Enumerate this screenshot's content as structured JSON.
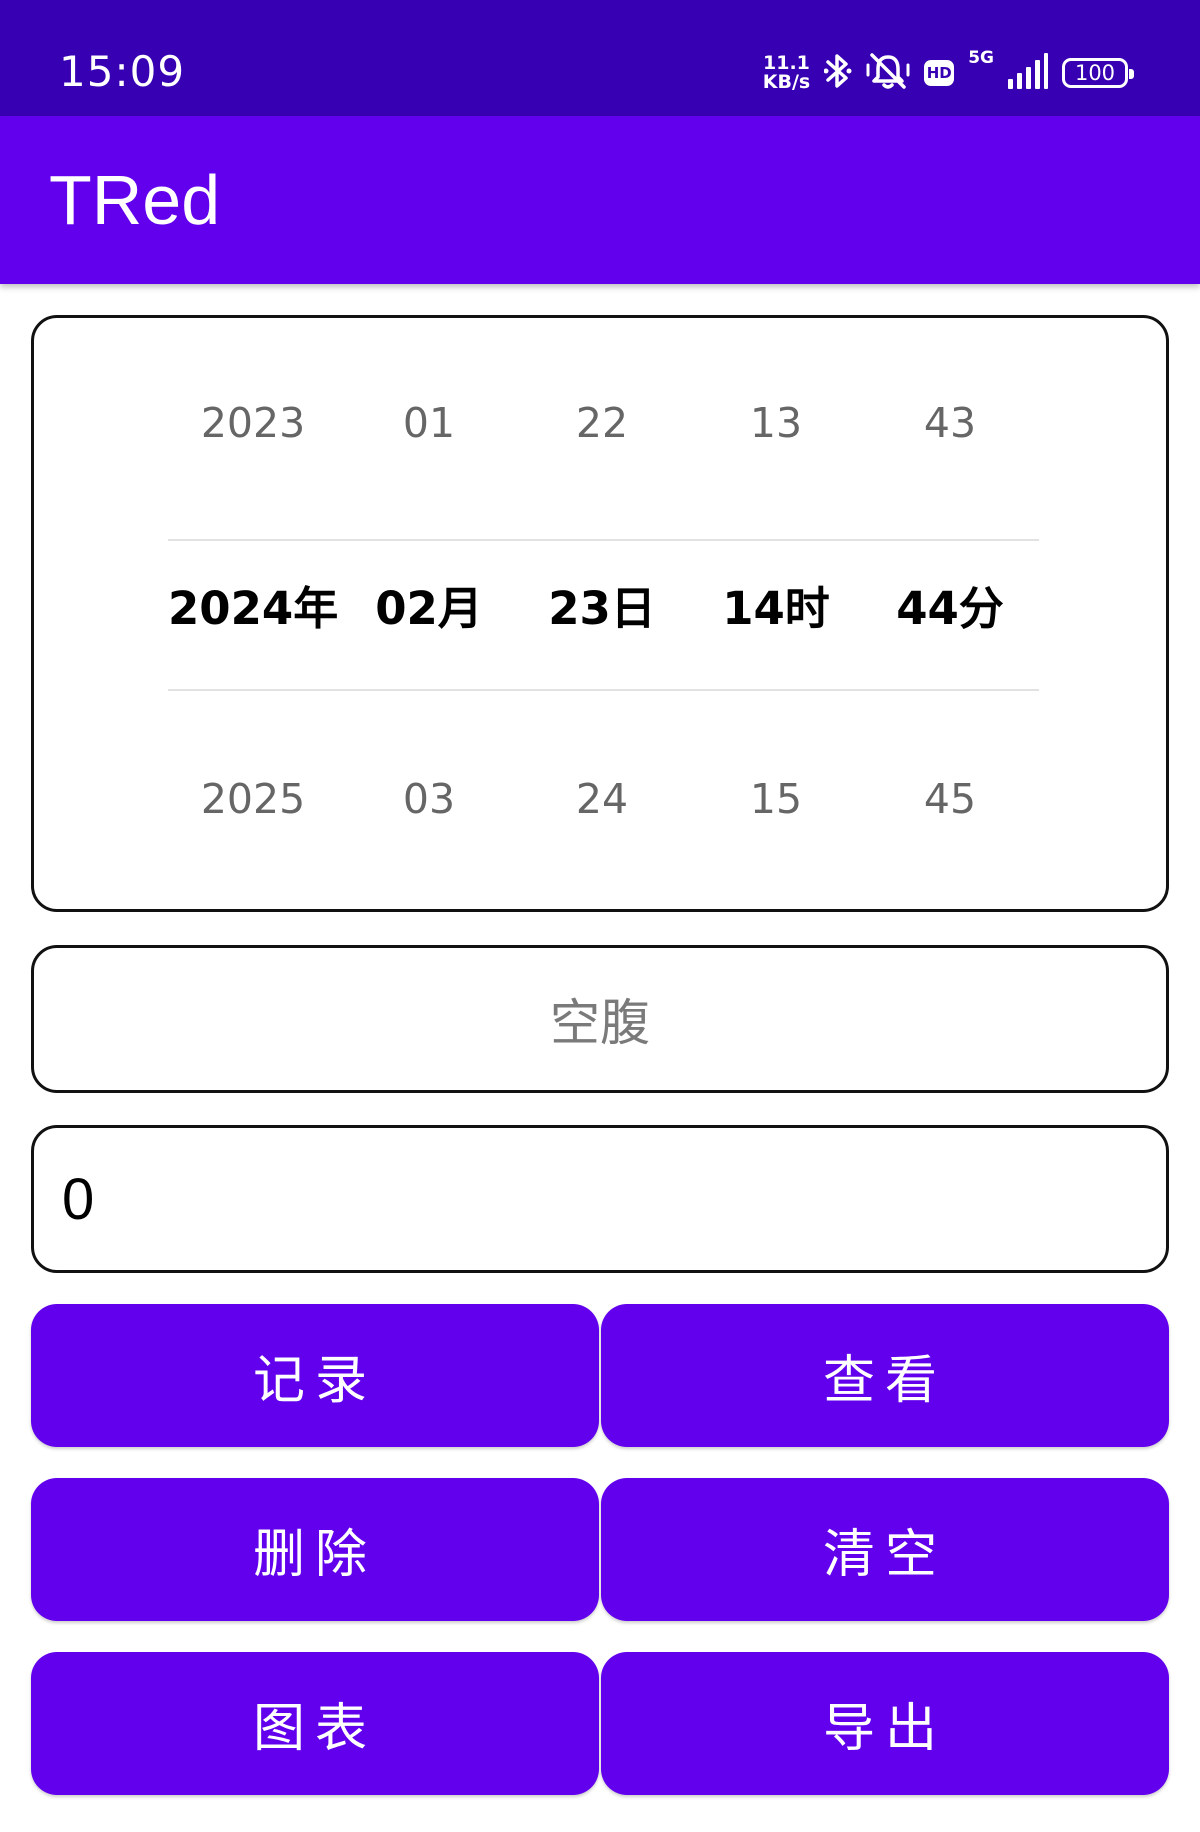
{
  "status_bar": {
    "time": "15:09",
    "net_speed_value": "11.1",
    "net_speed_unit": "KB/s",
    "hd_label": "HD",
    "network_type": "5G",
    "battery": "100",
    "icons": [
      "bluetooth-icon",
      "mute-icon",
      "hd-icon",
      "signal-icon",
      "battery-icon"
    ]
  },
  "app_bar": {
    "title": "TRed"
  },
  "date_picker": {
    "previous": [
      "2023",
      "01",
      "22",
      "13",
      "43"
    ],
    "selected": [
      "2024年",
      "02月",
      "23日",
      "14时",
      "44分"
    ],
    "next": [
      "2025",
      "03",
      "24",
      "15",
      "45"
    ]
  },
  "meal_selector": {
    "value": "空腹"
  },
  "glucose_input": {
    "value": "0"
  },
  "buttons": {
    "record": "记录",
    "view": "查看",
    "delete": "删除",
    "clear": "清空",
    "chart": "图表",
    "export": "导出"
  },
  "colors": {
    "status_bar": "#3700b3",
    "primary": "#6200ee"
  }
}
